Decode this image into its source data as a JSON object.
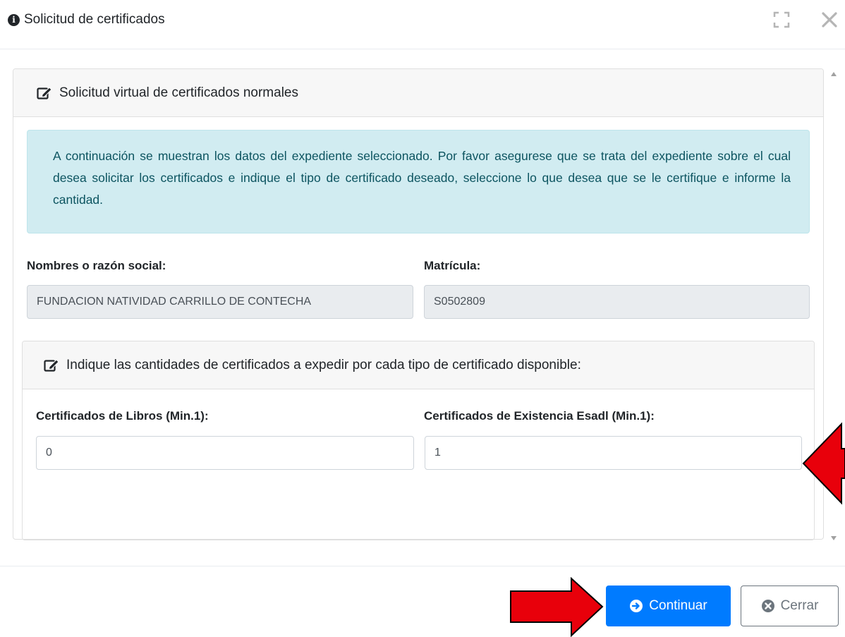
{
  "modal": {
    "title": "Solicitud de certificados"
  },
  "card": {
    "title": "Solicitud virtual de certificados normales",
    "alert_text": "A continuación se muestran los datos del expediente seleccionado. Por favor asegurese que se trata del expediente sobre el cual desea solicitar los certificados e indique el tipo de certificado deseado, seleccione lo que desea que se le certifique e informe la cantidad."
  },
  "fields": {
    "nombre_label": "Nombres o razón social:",
    "nombre_value": "FUNDACION NATIVIDAD CARRILLO DE CONTECHA",
    "matricula_label": "Matrícula:",
    "matricula_value": "S0502809"
  },
  "cantidades": {
    "title": "Indique las cantidades de certificados a expedir por cada tipo de certificado disponible:",
    "libros_label": "Certificados de Libros (Min.1):",
    "libros_value": "0",
    "existencia_label": "Certificados de Existencia Esadl (Min.1):",
    "existencia_value": "1"
  },
  "footer": {
    "continuar_label": "Continuar",
    "cerrar_label": "Cerrar"
  },
  "colors": {
    "primary": "#007bff",
    "alert_bg": "#d1ecf1",
    "alert_text": "#0c5460",
    "annotation_arrow": "#e8000b"
  },
  "icons": {
    "title": "info-circle-icon",
    "maximize": "maximize-icon",
    "close": "close-icon",
    "edit": "edit-icon",
    "continuar": "arrow-circle-right-icon",
    "cerrar": "times-circle-icon"
  }
}
